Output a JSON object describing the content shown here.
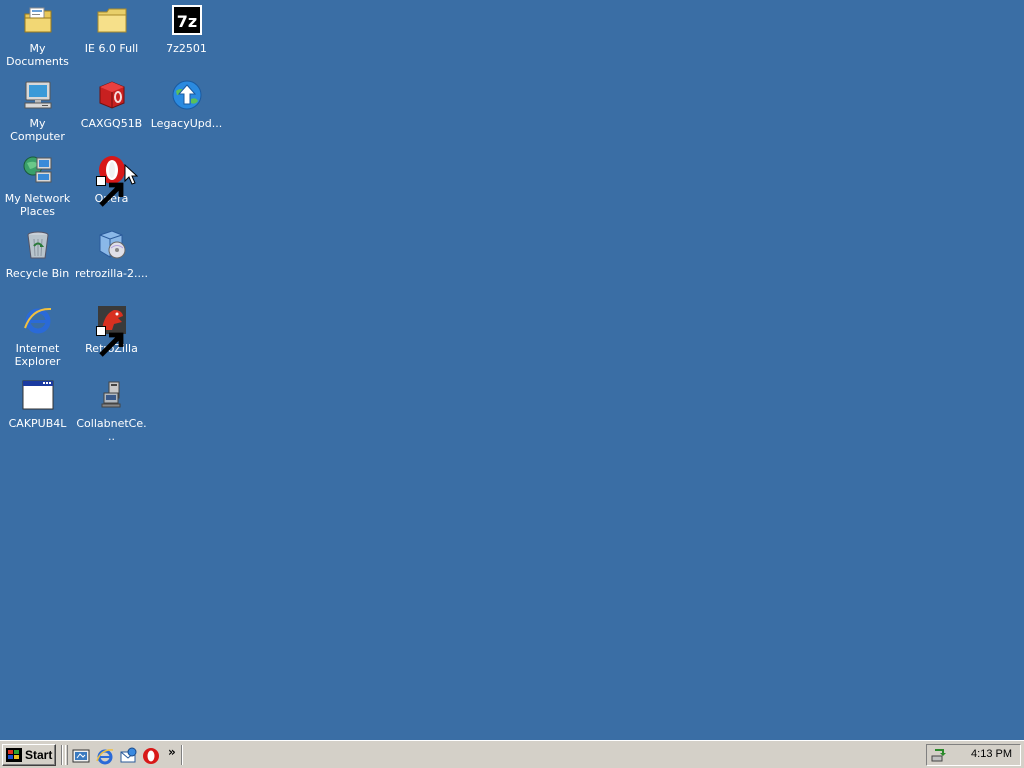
{
  "desktop": {
    "background_color": "#3a6ea5",
    "icons": [
      {
        "label": "My Documents",
        "icon": "my-documents-icon"
      },
      {
        "label": "IE 6.0 Full",
        "icon": "folder-icon"
      },
      {
        "label": "7z2501",
        "icon": "7zip-icon"
      },
      {
        "label": "My Computer",
        "icon": "my-computer-icon"
      },
      {
        "label": "CAXGQ51B",
        "icon": "red-box-icon"
      },
      {
        "label": "LegacyUpd...",
        "icon": "legacy-update-icon"
      },
      {
        "label": "My Network Places",
        "icon": "network-places-icon"
      },
      {
        "label": "Opera",
        "icon": "opera-icon"
      },
      {
        "label": "Recycle Bin",
        "icon": "recycle-bin-icon"
      },
      {
        "label": "retrozilla-2....",
        "icon": "installer-icon"
      },
      {
        "label": "Internet Explorer",
        "icon": "internet-explorer-icon"
      },
      {
        "label": "RetroZilla",
        "icon": "retrozilla-icon"
      },
      {
        "label": "CAKPUB4L",
        "icon": "window-icon"
      },
      {
        "label": "CollabnetCe...",
        "icon": "collabnet-icon"
      }
    ]
  },
  "taskbar": {
    "start_label": "Start",
    "quick_launch": [
      {
        "icon": "show-desktop-icon"
      },
      {
        "icon": "internet-explorer-icon"
      },
      {
        "icon": "outlook-express-icon"
      },
      {
        "icon": "opera-icon"
      }
    ],
    "more_label": "»",
    "clock": "4:13 PM"
  }
}
